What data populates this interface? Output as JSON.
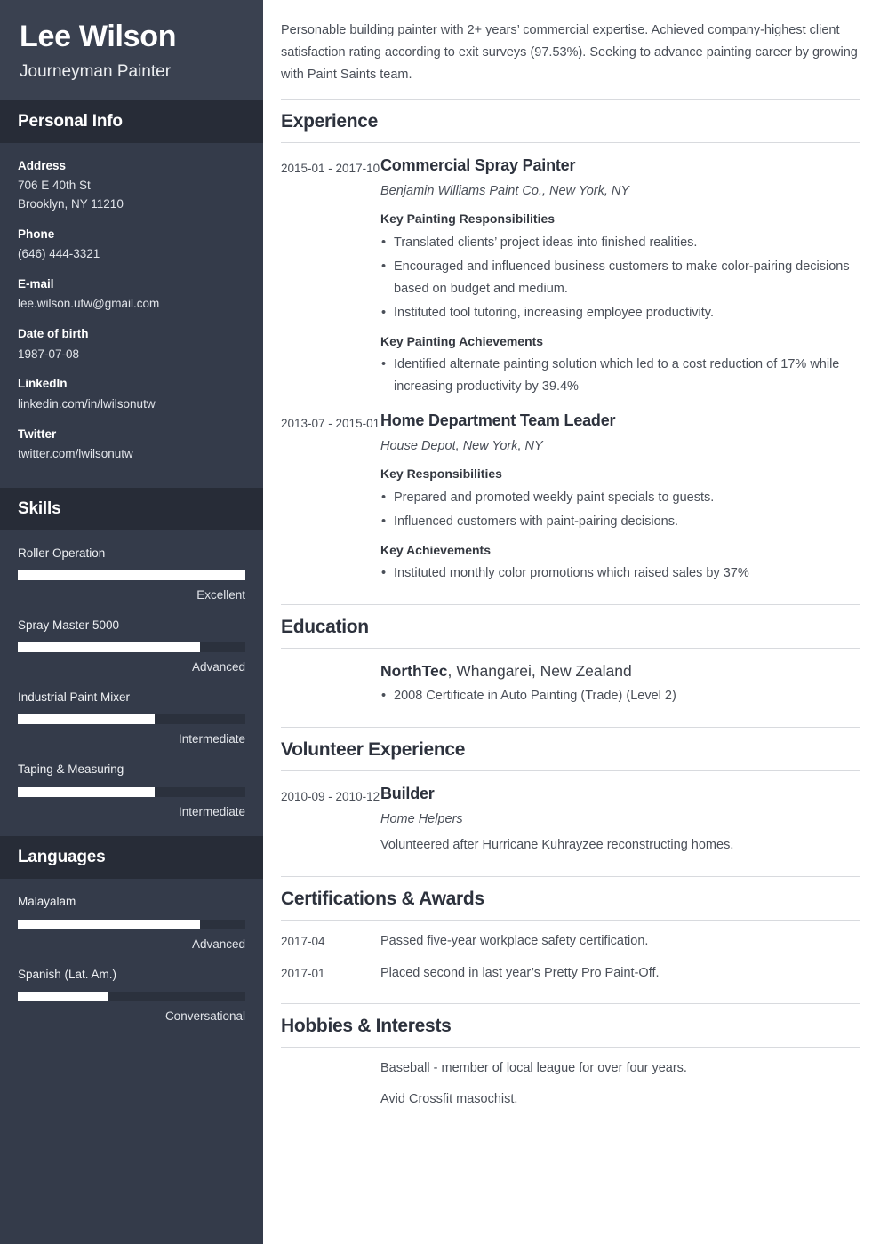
{
  "sidebar": {
    "name": "Lee Wilson",
    "job_title": "Journeyman Painter",
    "personal_info": {
      "heading": "Personal Info",
      "fields": [
        {
          "label": "Address",
          "value": "706 E 40th St",
          "value2": "Brooklyn, NY 11210"
        },
        {
          "label": "Phone",
          "value": "(646) 444-3321"
        },
        {
          "label": "E-mail",
          "value": "lee.wilson.utw@gmail.com"
        },
        {
          "label": "Date of birth",
          "value": "1987-07-08"
        },
        {
          "label": "LinkedIn",
          "value": "linkedin.com/in/lwilsonutw"
        },
        {
          "label": "Twitter",
          "value": "twitter.com/lwilsonutw"
        }
      ]
    },
    "skills": {
      "heading": "Skills",
      "items": [
        {
          "name": "Roller Operation",
          "level": "Excellent",
          "percent": 100
        },
        {
          "name": "Spray Master 5000",
          "level": "Advanced",
          "percent": 80
        },
        {
          "name": "Industrial Paint Mixer",
          "level": "Intermediate",
          "percent": 60
        },
        {
          "name": "Taping & Measuring",
          "level": "Intermediate",
          "percent": 60
        }
      ]
    },
    "languages": {
      "heading": "Languages",
      "items": [
        {
          "name": "Malayalam",
          "level": "Advanced",
          "percent": 80
        },
        {
          "name": "Spanish (Lat. Am.)",
          "level": "Conversational",
          "percent": 40
        }
      ]
    }
  },
  "main": {
    "summary": "Personable building painter with 2+ years’ commercial expertise. Achieved company-highest client satisfaction rating according to exit surveys (97.53%). Seeking to advance painting career by growing with Paint Saints team.",
    "experience": {
      "heading": "Experience",
      "entries": [
        {
          "dates": "2015-01 - 2017-10",
          "role": "Commercial Spray Painter",
          "org": "Benjamin Williams Paint Co., New York, NY",
          "sub1": "Key Painting Responsibilities",
          "bullets1": [
            "Translated clients’ project ideas into finished realities.",
            "Encouraged and influenced business customers to make color-pairing decisions based on budget and medium.",
            "Instituted tool tutoring, increasing employee productivity."
          ],
          "sub2": "Key Painting Achievements",
          "bullets2": [
            "Identified alternate painting solution which led to a cost reduction of 17% while increasing productivity by 39.4%"
          ]
        },
        {
          "dates": "2013-07 - 2015-01",
          "role": "Home Department Team Leader",
          "org": "House Depot, New York, NY",
          "sub1": "Key Responsibilities",
          "bullets1": [
            "Prepared and promoted weekly paint specials to guests.",
            "Influenced customers with paint-pairing decisions."
          ],
          "sub2": "Key Achievements",
          "bullets2": [
            "Instituted monthly color promotions which raised sales by 37%"
          ]
        }
      ]
    },
    "education": {
      "heading": "Education",
      "school_bold": "NorthTec",
      "school_rest": ", Whangarei, New Zealand",
      "bullets": [
        "2008 Certificate in Auto Painting (Trade) (Level 2)"
      ]
    },
    "volunteer": {
      "heading": "Volunteer Experience",
      "dates": "2010-09 - 2010-12",
      "role": "Builder",
      "org": "Home Helpers",
      "description": "Volunteered after Hurricane Kuhrayzee reconstructing homes."
    },
    "certifications": {
      "heading": "Certifications & Awards",
      "rows": [
        {
          "date": "2017-04",
          "text": "Passed five-year workplace safety certification."
        },
        {
          "date": "2017-01",
          "text": "Placed second in last year’s Pretty Pro Paint-Off."
        }
      ]
    },
    "hobbies": {
      "heading": "Hobbies & Interests",
      "rows": [
        {
          "date": "",
          "text": "Baseball - member of local league for over four years."
        },
        {
          "date": "",
          "text": "Avid Crossfit masochist."
        }
      ]
    }
  }
}
